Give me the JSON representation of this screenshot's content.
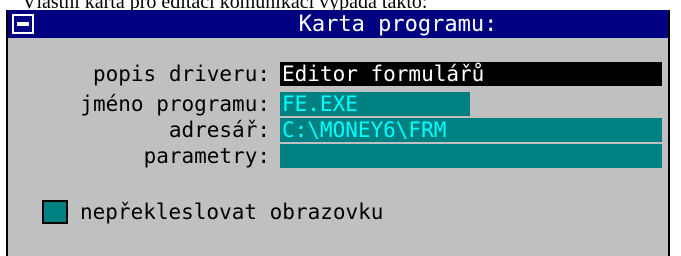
{
  "document": {
    "caption": "Vlastní karta pro editaci komunikací vypadá takto:"
  },
  "window": {
    "title": "Karta programu:"
  },
  "fields": [
    {
      "label": "popis driveru:",
      "value": "Editor formulářů"
    },
    {
      "label": "jméno programu:",
      "value": "FE.EXE"
    },
    {
      "label": "adresář:",
      "value": "C:\\MONEY6\\FRM"
    },
    {
      "label": "parametry:",
      "value": ""
    }
  ],
  "checkbox": {
    "label": "nepřekleslovat obrazovku",
    "checked": false
  },
  "colors": {
    "titlebar": "#000080",
    "dialog_bg": "#c0c0c0",
    "field_bg": "#008080",
    "field_text": "#00ffff",
    "active_field_bg": "#000000"
  }
}
